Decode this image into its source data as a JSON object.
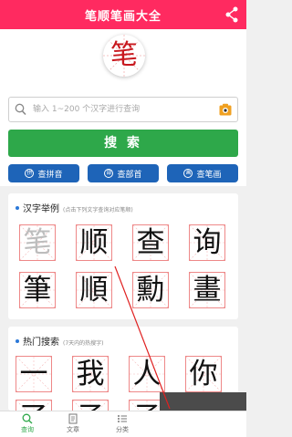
{
  "app": {
    "title": "笔顺笔画大全"
  },
  "logo": {
    "char": "笔"
  },
  "search": {
    "placeholder": "输入 1~200 个汉字进行查询",
    "button_label": "搜 索"
  },
  "quick_buttons": [
    {
      "label": "查拼音"
    },
    {
      "label": "查部首"
    },
    {
      "label": "查笔画"
    }
  ],
  "examples": {
    "title": "汉字举例",
    "hint": "(点击下列文字查询对应笔顺)",
    "row1": [
      "笔",
      "顺",
      "查",
      "询"
    ],
    "row2": [
      "筆",
      "順",
      "勳",
      "畫"
    ]
  },
  "hot": {
    "title": "热门搜索",
    "hint": "(7天内的热搜字)",
    "row1": [
      "一",
      "我",
      "人",
      "你"
    ],
    "row2": [
      "了",
      "子",
      "子",
      "了"
    ]
  },
  "nav": [
    {
      "label": "查询"
    },
    {
      "label": "文章"
    },
    {
      "label": "分类"
    }
  ],
  "colors": {
    "header": "#ff2a60",
    "search_button": "#2ea84a",
    "quick_button": "#1e64b8"
  }
}
